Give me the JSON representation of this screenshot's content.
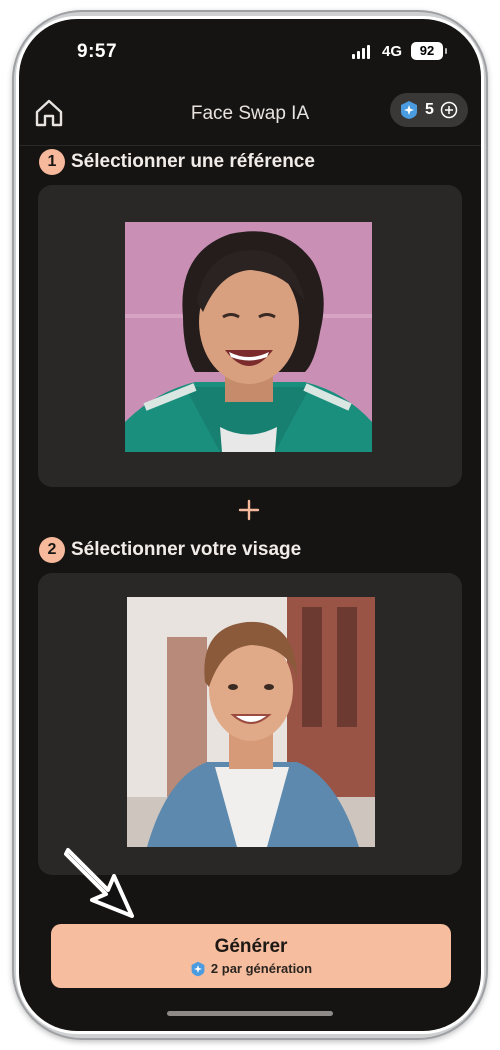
{
  "status_bar": {
    "time": "9:57",
    "network": "4G",
    "battery": "92"
  },
  "header": {
    "title": "Face Swap IA",
    "credits": "5",
    "icons": {
      "home": "home-icon",
      "gem": "gem-icon",
      "add": "plus-circle-icon"
    }
  },
  "steps": [
    {
      "number": "1",
      "label": "Sélectionner une référence",
      "photo": "reference-face-photo"
    },
    {
      "number": "2",
      "label": "Sélectionner votre visage",
      "photo": "user-face-photo"
    }
  ],
  "separator_icon": "plus-icon",
  "generate": {
    "label": "Générer",
    "cost_text": "2 par génération"
  },
  "colors": {
    "accent": "#f6b99b",
    "background": "#161413",
    "card": "#2a2826"
  }
}
